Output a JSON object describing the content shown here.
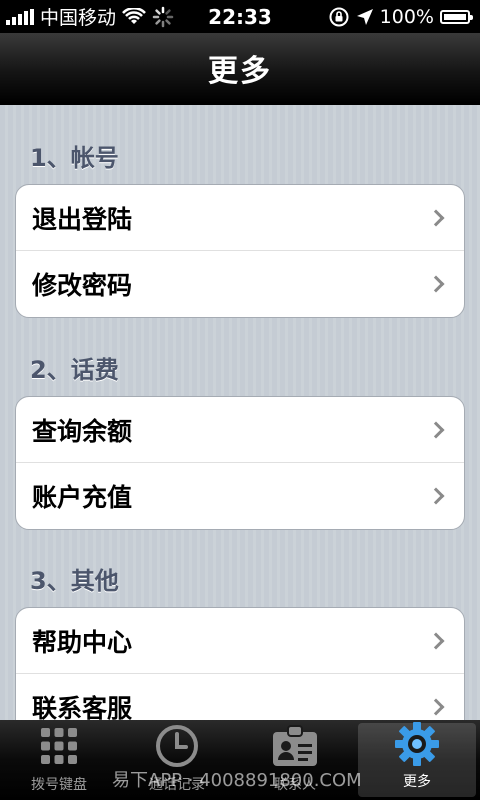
{
  "status_bar": {
    "carrier": "中国移动",
    "time": "22:33",
    "battery": "100%"
  },
  "nav": {
    "title": "更多"
  },
  "sections": [
    {
      "header": "1、帐号",
      "items": [
        "退出登陆",
        "修改密码"
      ]
    },
    {
      "header": "2、话费",
      "items": [
        "查询余额",
        "账户充值"
      ]
    },
    {
      "header": "3、其他",
      "items": [
        "帮助中心",
        "联系客服"
      ]
    }
  ],
  "tabs": [
    {
      "label": "拨号键盘",
      "icon": "keypad-icon",
      "active": false
    },
    {
      "label": "通话记录",
      "icon": "clock-icon",
      "active": false
    },
    {
      "label": "联系人",
      "icon": "contact-card-icon",
      "active": false
    },
    {
      "label": "更多",
      "icon": "gear-icon",
      "active": true
    }
  ],
  "watermark": "易下APP · 4008891800.COM"
}
